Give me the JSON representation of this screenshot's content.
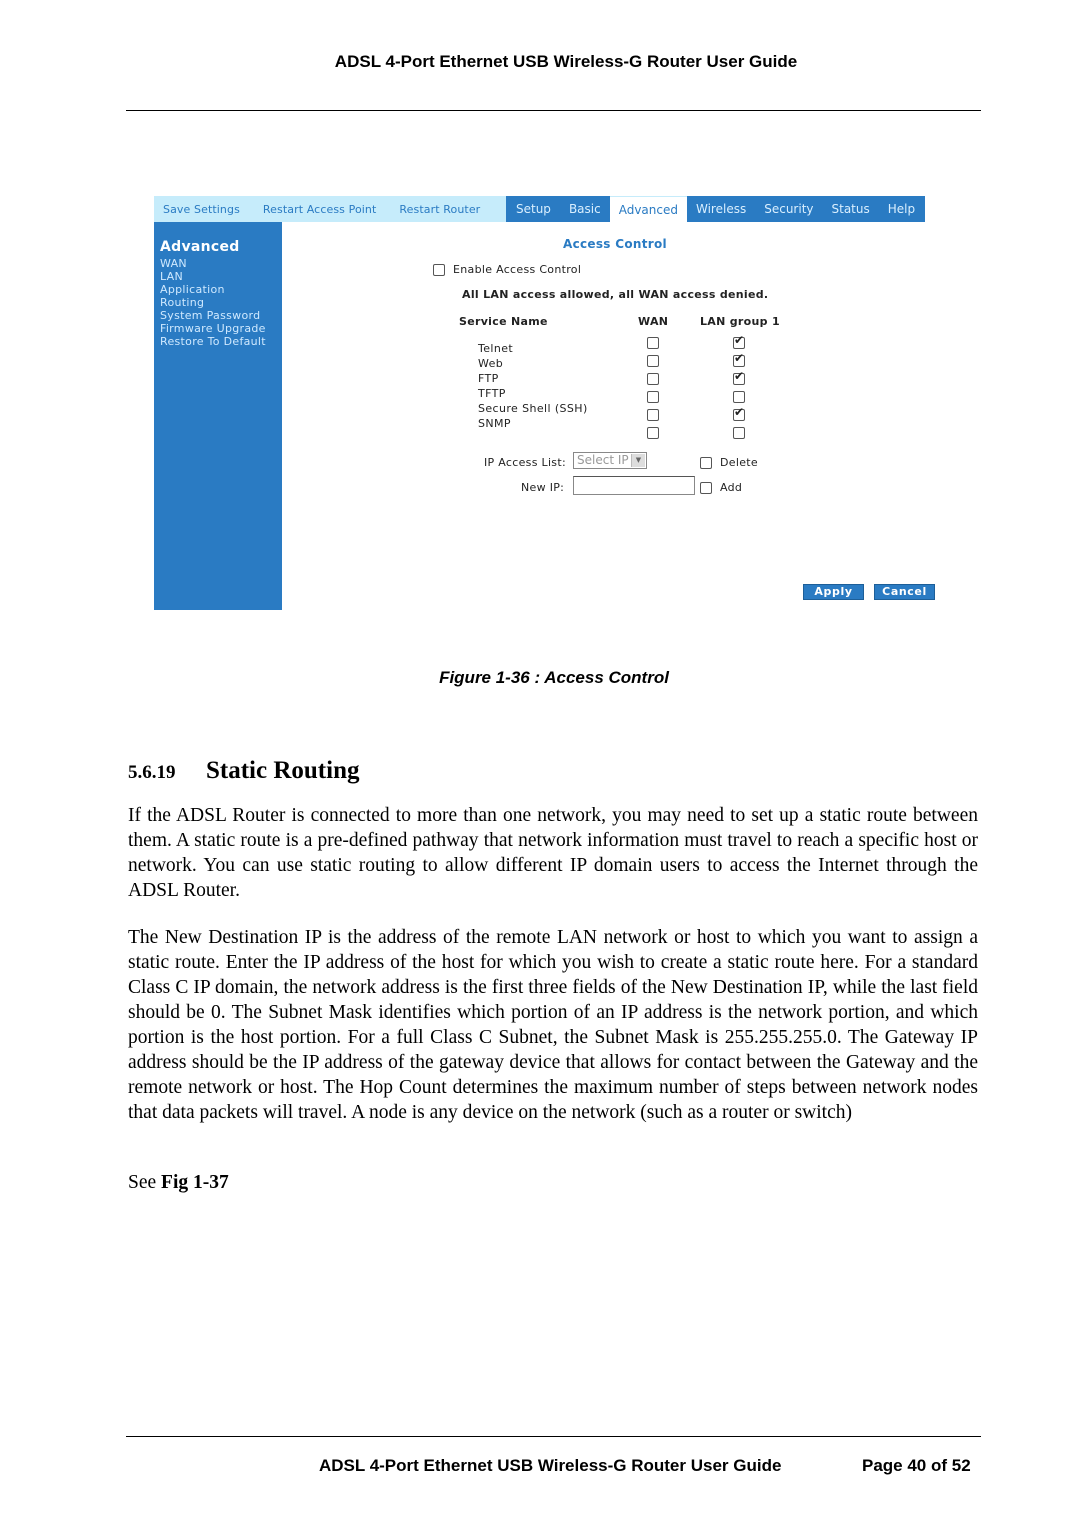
{
  "document": {
    "running_header": "ADSL 4-Port Ethernet USB Wireless-G Router User Guide",
    "figure_caption": "Figure 1-36 : Access Control",
    "section": {
      "number": "5.6.19",
      "title": "Static Routing"
    },
    "paragraphs": [
      "If the ADSL Router is connected to more than one network, you may need to set up a static route between them. A static route is a pre-defined pathway that network information must travel to reach a specific host or network. You can use static routing to allow different IP domain users to access the Internet through the ADSL Router.",
      "The New Destination IP is the address of the remote LAN network or host to which you want to assign a static route. Enter the IP address of the host for which you wish to create a static route here. For a standard Class C IP domain, the network address is the first three fields of the New Destination IP, while the last field should be 0.  The Subnet Mask identifies which portion of an IP address is the network portion, and which portion is the host portion. For a full Class C Subnet, the Subnet Mask is 255.255.255.0.  The Gateway IP address should be the IP address of the gateway device that allows for contact between the Gateway and the remote network or host. The Hop Count determines the maximum number of steps between network nodes that data packets will travel. A node is any device on the network (such as a router or switch)"
    ],
    "see_prefix": "See ",
    "see_ref": "Fig 1-37",
    "footer": {
      "title": "ADSL 4-Port Ethernet USB Wireless-G Router User Guide",
      "page": "Page 40 of 52"
    }
  },
  "router_ui": {
    "colors": {
      "primary_blue": "#2a7bc3",
      "utility_bar": "#c6ecfb"
    },
    "utility_links": [
      "Save Settings",
      "Restart Access Point",
      "Restart Router"
    ],
    "tabs": [
      {
        "label": "Setup",
        "active": false
      },
      {
        "label": "Basic",
        "active": false
      },
      {
        "label": "Advanced",
        "active": true
      },
      {
        "label": "Wireless",
        "active": false
      },
      {
        "label": "Security",
        "active": false
      },
      {
        "label": "Status",
        "active": false
      },
      {
        "label": "Help",
        "active": false
      }
    ],
    "sidebar": {
      "title": "Advanced",
      "items": [
        "WAN",
        "LAN",
        "Application",
        "Routing",
        "System Password",
        "Firmware Upgrade",
        "Restore To Default"
      ]
    },
    "page_title": "Access Control",
    "enable_access_control": {
      "label": "Enable Access Control",
      "checked": false
    },
    "notice": "All LAN access allowed, all WAN access denied.",
    "table": {
      "headers": {
        "service": "Service Name",
        "wan": "WAN",
        "lan": "LAN group 1"
      },
      "rows": [
        {
          "name": "Telnet",
          "wan": false,
          "lan": true
        },
        {
          "name": "Web",
          "wan": false,
          "lan": true
        },
        {
          "name": "FTP",
          "wan": false,
          "lan": true
        },
        {
          "name": "TFTP",
          "wan": false,
          "lan": false
        },
        {
          "name": "Secure Shell (SSH)",
          "wan": false,
          "lan": true
        },
        {
          "name": "SNMP",
          "wan": false,
          "lan": false
        }
      ]
    },
    "ip_access_list": {
      "label": "IP Access List:",
      "selected": "Select IP"
    },
    "delete": {
      "label": "Delete",
      "checked": false
    },
    "new_ip": {
      "label": "New IP:",
      "value": ""
    },
    "add": {
      "label": "Add",
      "checked": false
    },
    "buttons": {
      "apply": "Apply",
      "cancel": "Cancel"
    }
  }
}
